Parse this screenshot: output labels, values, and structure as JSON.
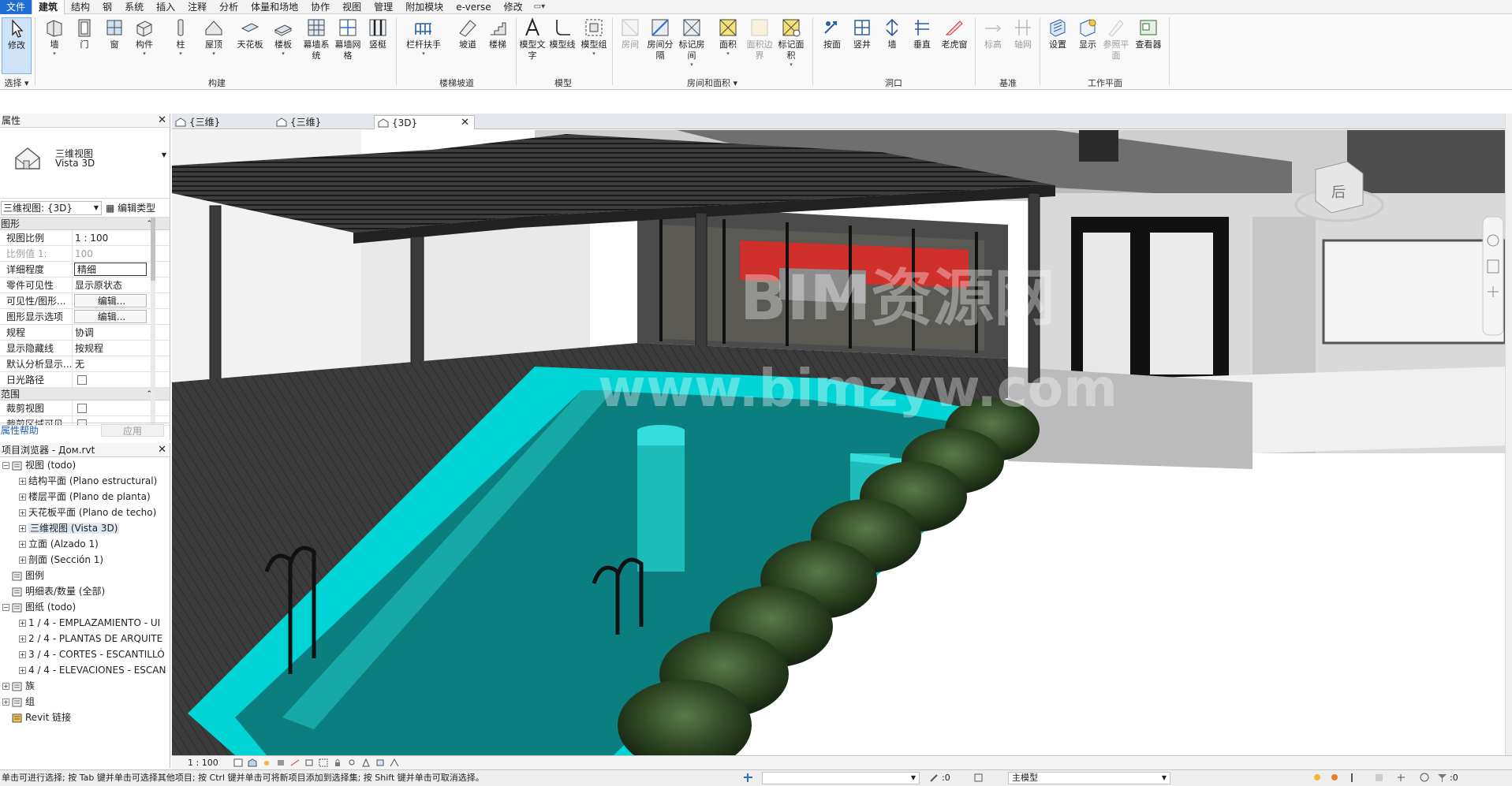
{
  "menu": {
    "items": [
      "文件",
      "建筑",
      "结构",
      "钢",
      "系统",
      "插入",
      "注释",
      "分析",
      "体量和场地",
      "协作",
      "视图",
      "管理",
      "附加模块",
      "e-verse",
      "修改"
    ]
  },
  "ribbon": {
    "buttons": {
      "modify": "修改",
      "wall": "墙",
      "door": "门",
      "window": "窗",
      "component": "构件",
      "column": "柱",
      "roof": "屋顶",
      "ceiling": "天花板",
      "floor": "楼板",
      "curtain_system": "幕墙系统",
      "curtain_grid": "幕墙网格",
      "mullion": "竖梃",
      "railing": "栏杆扶手",
      "ramp": "坡道",
      "stair": "楼梯",
      "model_text": "模型文字",
      "model_line": "模型线",
      "model_group": "模型组",
      "room": "房间",
      "room_separator": "房间分隔",
      "tag_room": "标记房间",
      "area": "面积",
      "area_boundary": "面积边界",
      "tag_area": "标记面积",
      "by_face": "按面",
      "shaft": "竖井",
      "opening_wall": "墙",
      "vertical": "垂直",
      "dormer": "老虎窗",
      "level": "标高",
      "grid": "轴网",
      "set": "设置",
      "show": "显示",
      "ref_plane": "参照平面",
      "viewer": "查看器"
    },
    "panels": {
      "select": "选择",
      "build": "构建",
      "circulation": "楼梯坡道",
      "model": "模型",
      "room_area": "房间和面积",
      "opening": "洞口",
      "datum": "基准",
      "workplane": "工作平面"
    }
  },
  "properties": {
    "title": "属性",
    "type_line1": "三维视图",
    "type_line2": "Vista 3D",
    "view_selector": "三维视图: {3D}",
    "edit_type": "编辑类型",
    "section_graphics": "图形",
    "section_extents": "范围",
    "rows": [
      {
        "k": "视图比例",
        "v": "1 : 100"
      },
      {
        "k": "比例值 1:",
        "v": "100"
      },
      {
        "k": "详细程度",
        "v": "精细"
      },
      {
        "k": "零件可见性",
        "v": "显示原状态"
      },
      {
        "k": "可见性/图形...",
        "v": "编辑..."
      },
      {
        "k": "图形显示选项",
        "v": "编辑..."
      },
      {
        "k": "规程",
        "v": "协调"
      },
      {
        "k": "显示隐藏线",
        "v": "按规程"
      },
      {
        "k": "默认分析显示...",
        "v": "无"
      },
      {
        "k": "日光路径",
        "v": ""
      },
      {
        "k": "裁剪视图",
        "v": ""
      },
      {
        "k": "裁剪区域可见",
        "v": ""
      }
    ],
    "help": "属性帮助",
    "apply": "应用"
  },
  "browser": {
    "title": "项目浏览器 - Дом.rvt",
    "nodes": [
      {
        "label": "视图 (todo)",
        "level": 0
      },
      {
        "label": "结构平面 (Plano estructural)",
        "level": 1
      },
      {
        "label": "楼层平面 (Plano de planta)",
        "level": 1
      },
      {
        "label": "天花板平面 (Plano de techo)",
        "level": 1
      },
      {
        "label": "三维视图 (Vista 3D)",
        "level": 1
      },
      {
        "label": "立面 (Alzado 1)",
        "level": 1
      },
      {
        "label": "剖面 (Sección 1)",
        "level": 1
      },
      {
        "label": "图例",
        "level": 0
      },
      {
        "label": "明细表/数量 (全部)",
        "level": 0
      },
      {
        "label": "图纸 (todo)",
        "level": 0
      },
      {
        "label": "1 / 4 - EMPLAZAMIENTO - UI",
        "level": 1
      },
      {
        "label": "2 / 4 - PLANTAS DE ARQUITE",
        "level": 1
      },
      {
        "label": "3 / 4 - CORTES - ESCANTILLÓ",
        "level": 1
      },
      {
        "label": "4 / 4 - ELEVACIONES - ESCAN",
        "level": 1
      },
      {
        "label": "族",
        "level": 0
      },
      {
        "label": "组",
        "level": 0
      },
      {
        "label": "Revit 链接",
        "level": 0
      }
    ]
  },
  "tabs": [
    {
      "label": "{三维}"
    },
    {
      "label": "{三维}"
    },
    {
      "label": "{3D}"
    }
  ],
  "viewport": {
    "watermark1": "BIM资源网",
    "watermark2": "www.bimzyw.com",
    "viewcube_face": "后"
  },
  "viewbar": {
    "scale": "1 : 100"
  },
  "status": {
    "message": "单击可进行选择; 按 Tab 键并单击可选择其他项目; 按 Ctrl 键并单击可将新项目添加到选择集; 按 Shift 键并单击可取消选择。",
    "worksets": ":0",
    "model": "主模型",
    "filter": ":0"
  },
  "colors": {
    "accent": "#1f6ed4",
    "pool": "#00cfcf",
    "pool_dark": "#0a7e80",
    "deck": "#3a3a3a"
  }
}
